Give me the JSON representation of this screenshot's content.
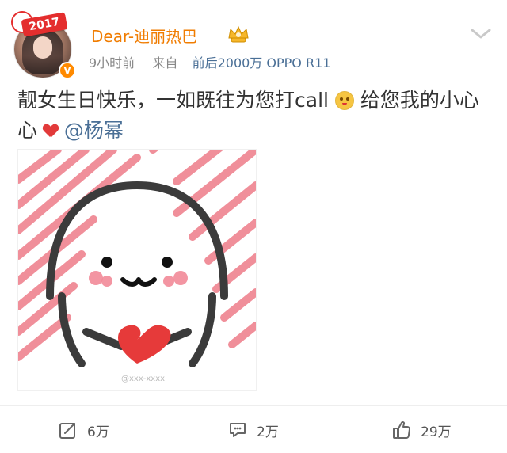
{
  "header": {
    "badge_year": "2017",
    "display_name": "Dear-迪丽热巴",
    "time_ago": "9小时前",
    "source_prefix": "来自",
    "source_text": "前后2000万 OPPO R11"
  },
  "post": {
    "text_part1": "靓女生日快乐，一如既往为您打call",
    "text_part2": "给您我的小心",
    "text_part3": "心",
    "mention": "@杨幂"
  },
  "image": {
    "watermark": "@xxx-xxxx"
  },
  "actions": {
    "repost_count": "6万",
    "comment_count": "2万",
    "like_count": "29万"
  },
  "icons": {
    "chevron": "chevron-down-icon",
    "crown": "crown-icon",
    "verified": "verified-icon",
    "emoji": "smile-emoji-icon",
    "heart": "heart-icon",
    "repost": "repost-icon",
    "comment": "comment-icon",
    "like": "thumbs-up-icon"
  },
  "colors": {
    "name_orange": "#f07c00",
    "link_blue": "#4a6f96",
    "verified_orange": "#ff8a00",
    "heart_red": "#e23a3a",
    "badge_red": "#e42e2e"
  }
}
